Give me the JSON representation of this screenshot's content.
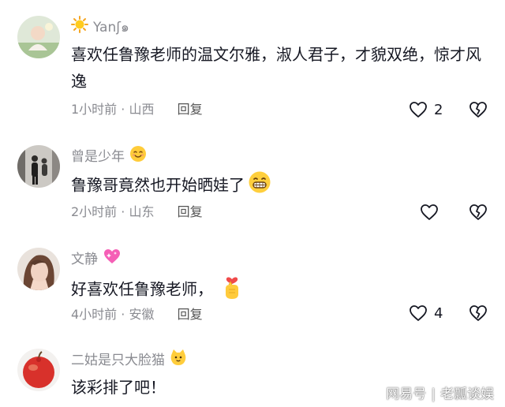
{
  "comments": [
    {
      "username": "Yan",
      "username_suffix": "ʃ๑",
      "username_emoji": "sun-emoji",
      "avatar": "baby-photo",
      "content": "喜欢任鲁豫老师的温文尔雅，淑人君子，才貌双绝，惊才风逸",
      "content_emoji": null,
      "time": "1小时前",
      "location": "山西",
      "reply_label": "回复",
      "likes": "2"
    },
    {
      "username": "曾是少年",
      "username_emoji": "smiling-face-emoji",
      "avatar": "two-people-photo",
      "content": "鲁豫哥竟然也开始晒娃了",
      "content_emoji": "grinning-face-emoji",
      "time": "2小时前",
      "location": "山东",
      "reply_label": "回复",
      "likes": ""
    },
    {
      "username": "文静",
      "username_emoji": "sparkling-heart-emoji",
      "avatar": "woman-photo",
      "content": "好喜欢任鲁豫老师，",
      "content_emoji": "finger-heart-hand-emoji",
      "time": "4小时前",
      "location": "安徽",
      "reply_label": "回复",
      "likes": "4"
    },
    {
      "username": "二姑是只大脸猫",
      "username_emoji": "cat-face-emoji",
      "avatar": "red-apple-photo",
      "content": "该彩排了吧！",
      "content_emoji": null
    }
  ],
  "separator": "·",
  "icons": {
    "like": "heart-outline-icon",
    "dislike": "broken-heart-icon"
  },
  "watermark": {
    "source": "网易号",
    "divider": "|",
    "author": "老瓢谈娱"
  }
}
